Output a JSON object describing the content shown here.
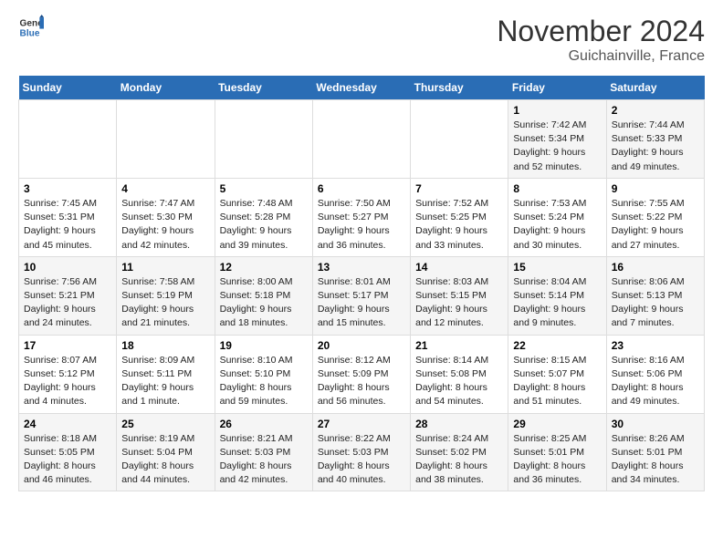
{
  "header": {
    "logo_general": "General",
    "logo_blue": "Blue",
    "title": "November 2024",
    "subtitle": "Guichainville, France"
  },
  "days_of_week": [
    "Sunday",
    "Monday",
    "Tuesday",
    "Wednesday",
    "Thursday",
    "Friday",
    "Saturday"
  ],
  "weeks": [
    {
      "days": [
        {
          "num": "",
          "detail": ""
        },
        {
          "num": "",
          "detail": ""
        },
        {
          "num": "",
          "detail": ""
        },
        {
          "num": "",
          "detail": ""
        },
        {
          "num": "",
          "detail": ""
        },
        {
          "num": "1",
          "detail": "Sunrise: 7:42 AM\nSunset: 5:34 PM\nDaylight: 9 hours\nand 52 minutes."
        },
        {
          "num": "2",
          "detail": "Sunrise: 7:44 AM\nSunset: 5:33 PM\nDaylight: 9 hours\nand 49 minutes."
        }
      ]
    },
    {
      "days": [
        {
          "num": "3",
          "detail": "Sunrise: 7:45 AM\nSunset: 5:31 PM\nDaylight: 9 hours\nand 45 minutes."
        },
        {
          "num": "4",
          "detail": "Sunrise: 7:47 AM\nSunset: 5:30 PM\nDaylight: 9 hours\nand 42 minutes."
        },
        {
          "num": "5",
          "detail": "Sunrise: 7:48 AM\nSunset: 5:28 PM\nDaylight: 9 hours\nand 39 minutes."
        },
        {
          "num": "6",
          "detail": "Sunrise: 7:50 AM\nSunset: 5:27 PM\nDaylight: 9 hours\nand 36 minutes."
        },
        {
          "num": "7",
          "detail": "Sunrise: 7:52 AM\nSunset: 5:25 PM\nDaylight: 9 hours\nand 33 minutes."
        },
        {
          "num": "8",
          "detail": "Sunrise: 7:53 AM\nSunset: 5:24 PM\nDaylight: 9 hours\nand 30 minutes."
        },
        {
          "num": "9",
          "detail": "Sunrise: 7:55 AM\nSunset: 5:22 PM\nDaylight: 9 hours\nand 27 minutes."
        }
      ]
    },
    {
      "days": [
        {
          "num": "10",
          "detail": "Sunrise: 7:56 AM\nSunset: 5:21 PM\nDaylight: 9 hours\nand 24 minutes."
        },
        {
          "num": "11",
          "detail": "Sunrise: 7:58 AM\nSunset: 5:19 PM\nDaylight: 9 hours\nand 21 minutes."
        },
        {
          "num": "12",
          "detail": "Sunrise: 8:00 AM\nSunset: 5:18 PM\nDaylight: 9 hours\nand 18 minutes."
        },
        {
          "num": "13",
          "detail": "Sunrise: 8:01 AM\nSunset: 5:17 PM\nDaylight: 9 hours\nand 15 minutes."
        },
        {
          "num": "14",
          "detail": "Sunrise: 8:03 AM\nSunset: 5:15 PM\nDaylight: 9 hours\nand 12 minutes."
        },
        {
          "num": "15",
          "detail": "Sunrise: 8:04 AM\nSunset: 5:14 PM\nDaylight: 9 hours\nand 9 minutes."
        },
        {
          "num": "16",
          "detail": "Sunrise: 8:06 AM\nSunset: 5:13 PM\nDaylight: 9 hours\nand 7 minutes."
        }
      ]
    },
    {
      "days": [
        {
          "num": "17",
          "detail": "Sunrise: 8:07 AM\nSunset: 5:12 PM\nDaylight: 9 hours\nand 4 minutes."
        },
        {
          "num": "18",
          "detail": "Sunrise: 8:09 AM\nSunset: 5:11 PM\nDaylight: 9 hours\nand 1 minute."
        },
        {
          "num": "19",
          "detail": "Sunrise: 8:10 AM\nSunset: 5:10 PM\nDaylight: 8 hours\nand 59 minutes."
        },
        {
          "num": "20",
          "detail": "Sunrise: 8:12 AM\nSunset: 5:09 PM\nDaylight: 8 hours\nand 56 minutes."
        },
        {
          "num": "21",
          "detail": "Sunrise: 8:14 AM\nSunset: 5:08 PM\nDaylight: 8 hours\nand 54 minutes."
        },
        {
          "num": "22",
          "detail": "Sunrise: 8:15 AM\nSunset: 5:07 PM\nDaylight: 8 hours\nand 51 minutes."
        },
        {
          "num": "23",
          "detail": "Sunrise: 8:16 AM\nSunset: 5:06 PM\nDaylight: 8 hours\nand 49 minutes."
        }
      ]
    },
    {
      "days": [
        {
          "num": "24",
          "detail": "Sunrise: 8:18 AM\nSunset: 5:05 PM\nDaylight: 8 hours\nand 46 minutes."
        },
        {
          "num": "25",
          "detail": "Sunrise: 8:19 AM\nSunset: 5:04 PM\nDaylight: 8 hours\nand 44 minutes."
        },
        {
          "num": "26",
          "detail": "Sunrise: 8:21 AM\nSunset: 5:03 PM\nDaylight: 8 hours\nand 42 minutes."
        },
        {
          "num": "27",
          "detail": "Sunrise: 8:22 AM\nSunset: 5:03 PM\nDaylight: 8 hours\nand 40 minutes."
        },
        {
          "num": "28",
          "detail": "Sunrise: 8:24 AM\nSunset: 5:02 PM\nDaylight: 8 hours\nand 38 minutes."
        },
        {
          "num": "29",
          "detail": "Sunrise: 8:25 AM\nSunset: 5:01 PM\nDaylight: 8 hours\nand 36 minutes."
        },
        {
          "num": "30",
          "detail": "Sunrise: 8:26 AM\nSunset: 5:01 PM\nDaylight: 8 hours\nand 34 minutes."
        }
      ]
    }
  ]
}
